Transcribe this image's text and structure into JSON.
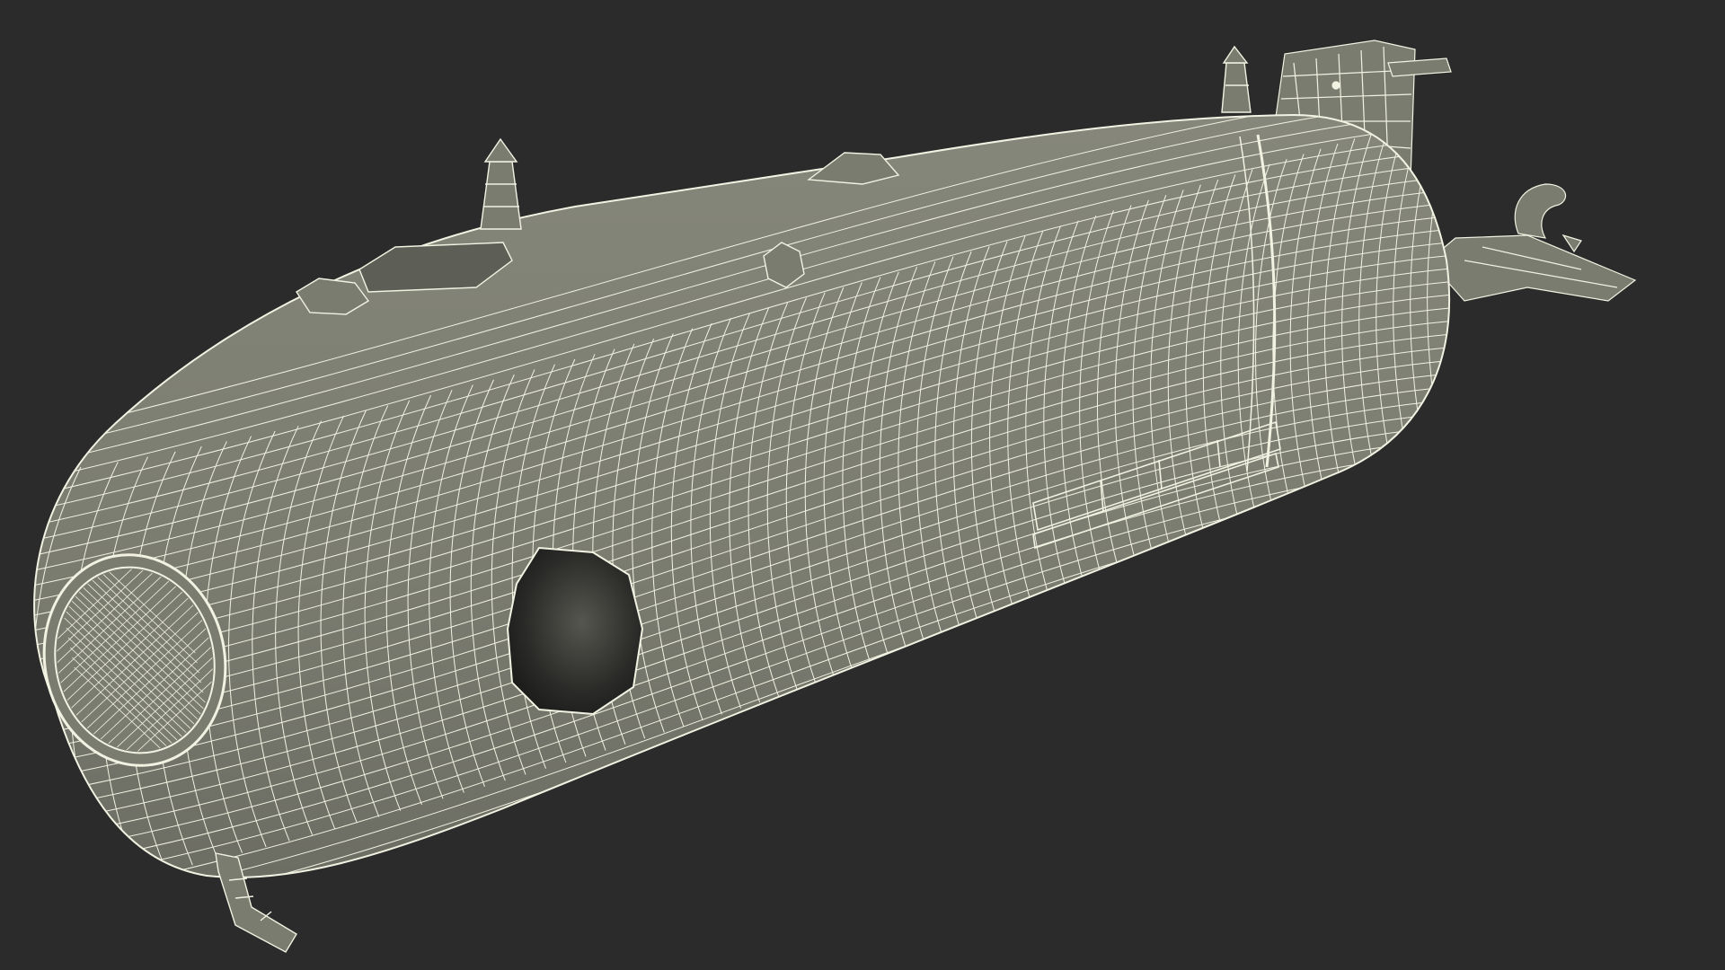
{
  "scene": {
    "subject": "submersible-wireframe",
    "render_mode": "wireframe",
    "colors": {
      "background": "#2b2b2b",
      "surface": "#7b7c70",
      "surface_dark": "#62635a",
      "wire": "#f2f2e2",
      "cavity": "#1c1d1b",
      "cavity_mid": "#4a4b45"
    }
  }
}
